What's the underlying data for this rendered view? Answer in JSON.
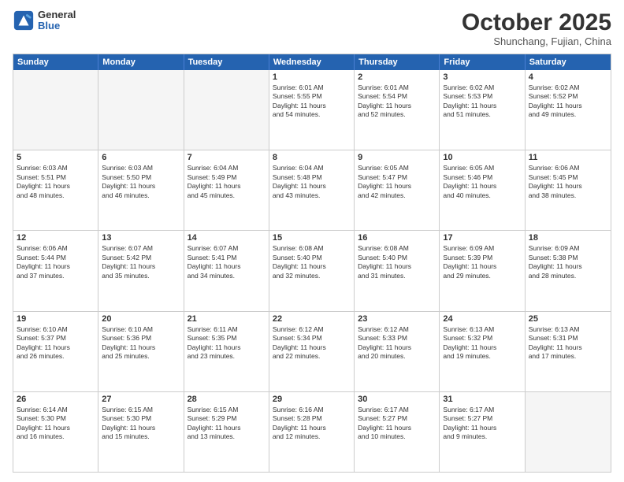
{
  "header": {
    "logo_general": "General",
    "logo_blue": "Blue",
    "month_title": "October 2025",
    "subtitle": "Shunchang, Fujian, China"
  },
  "weekdays": [
    "Sunday",
    "Monday",
    "Tuesday",
    "Wednesday",
    "Thursday",
    "Friday",
    "Saturday"
  ],
  "rows": [
    [
      {
        "day": "",
        "text": "",
        "empty": true
      },
      {
        "day": "",
        "text": "",
        "empty": true
      },
      {
        "day": "",
        "text": "",
        "empty": true
      },
      {
        "day": "1",
        "text": "Sunrise: 6:01 AM\nSunset: 5:55 PM\nDaylight: 11 hours\nand 54 minutes."
      },
      {
        "day": "2",
        "text": "Sunrise: 6:01 AM\nSunset: 5:54 PM\nDaylight: 11 hours\nand 52 minutes."
      },
      {
        "day": "3",
        "text": "Sunrise: 6:02 AM\nSunset: 5:53 PM\nDaylight: 11 hours\nand 51 minutes."
      },
      {
        "day": "4",
        "text": "Sunrise: 6:02 AM\nSunset: 5:52 PM\nDaylight: 11 hours\nand 49 minutes."
      }
    ],
    [
      {
        "day": "5",
        "text": "Sunrise: 6:03 AM\nSunset: 5:51 PM\nDaylight: 11 hours\nand 48 minutes."
      },
      {
        "day": "6",
        "text": "Sunrise: 6:03 AM\nSunset: 5:50 PM\nDaylight: 11 hours\nand 46 minutes."
      },
      {
        "day": "7",
        "text": "Sunrise: 6:04 AM\nSunset: 5:49 PM\nDaylight: 11 hours\nand 45 minutes."
      },
      {
        "day": "8",
        "text": "Sunrise: 6:04 AM\nSunset: 5:48 PM\nDaylight: 11 hours\nand 43 minutes."
      },
      {
        "day": "9",
        "text": "Sunrise: 6:05 AM\nSunset: 5:47 PM\nDaylight: 11 hours\nand 42 minutes."
      },
      {
        "day": "10",
        "text": "Sunrise: 6:05 AM\nSunset: 5:46 PM\nDaylight: 11 hours\nand 40 minutes."
      },
      {
        "day": "11",
        "text": "Sunrise: 6:06 AM\nSunset: 5:45 PM\nDaylight: 11 hours\nand 38 minutes."
      }
    ],
    [
      {
        "day": "12",
        "text": "Sunrise: 6:06 AM\nSunset: 5:44 PM\nDaylight: 11 hours\nand 37 minutes."
      },
      {
        "day": "13",
        "text": "Sunrise: 6:07 AM\nSunset: 5:42 PM\nDaylight: 11 hours\nand 35 minutes."
      },
      {
        "day": "14",
        "text": "Sunrise: 6:07 AM\nSunset: 5:41 PM\nDaylight: 11 hours\nand 34 minutes."
      },
      {
        "day": "15",
        "text": "Sunrise: 6:08 AM\nSunset: 5:40 PM\nDaylight: 11 hours\nand 32 minutes."
      },
      {
        "day": "16",
        "text": "Sunrise: 6:08 AM\nSunset: 5:40 PM\nDaylight: 11 hours\nand 31 minutes."
      },
      {
        "day": "17",
        "text": "Sunrise: 6:09 AM\nSunset: 5:39 PM\nDaylight: 11 hours\nand 29 minutes."
      },
      {
        "day": "18",
        "text": "Sunrise: 6:09 AM\nSunset: 5:38 PM\nDaylight: 11 hours\nand 28 minutes."
      }
    ],
    [
      {
        "day": "19",
        "text": "Sunrise: 6:10 AM\nSunset: 5:37 PM\nDaylight: 11 hours\nand 26 minutes."
      },
      {
        "day": "20",
        "text": "Sunrise: 6:10 AM\nSunset: 5:36 PM\nDaylight: 11 hours\nand 25 minutes."
      },
      {
        "day": "21",
        "text": "Sunrise: 6:11 AM\nSunset: 5:35 PM\nDaylight: 11 hours\nand 23 minutes."
      },
      {
        "day": "22",
        "text": "Sunrise: 6:12 AM\nSunset: 5:34 PM\nDaylight: 11 hours\nand 22 minutes."
      },
      {
        "day": "23",
        "text": "Sunrise: 6:12 AM\nSunset: 5:33 PM\nDaylight: 11 hours\nand 20 minutes."
      },
      {
        "day": "24",
        "text": "Sunrise: 6:13 AM\nSunset: 5:32 PM\nDaylight: 11 hours\nand 19 minutes."
      },
      {
        "day": "25",
        "text": "Sunrise: 6:13 AM\nSunset: 5:31 PM\nDaylight: 11 hours\nand 17 minutes."
      }
    ],
    [
      {
        "day": "26",
        "text": "Sunrise: 6:14 AM\nSunset: 5:30 PM\nDaylight: 11 hours\nand 16 minutes."
      },
      {
        "day": "27",
        "text": "Sunrise: 6:15 AM\nSunset: 5:30 PM\nDaylight: 11 hours\nand 15 minutes."
      },
      {
        "day": "28",
        "text": "Sunrise: 6:15 AM\nSunset: 5:29 PM\nDaylight: 11 hours\nand 13 minutes."
      },
      {
        "day": "29",
        "text": "Sunrise: 6:16 AM\nSunset: 5:28 PM\nDaylight: 11 hours\nand 12 minutes."
      },
      {
        "day": "30",
        "text": "Sunrise: 6:17 AM\nSunset: 5:27 PM\nDaylight: 11 hours\nand 10 minutes."
      },
      {
        "day": "31",
        "text": "Sunrise: 6:17 AM\nSunset: 5:27 PM\nDaylight: 11 hours\nand 9 minutes."
      },
      {
        "day": "",
        "text": "",
        "empty": true
      }
    ]
  ]
}
